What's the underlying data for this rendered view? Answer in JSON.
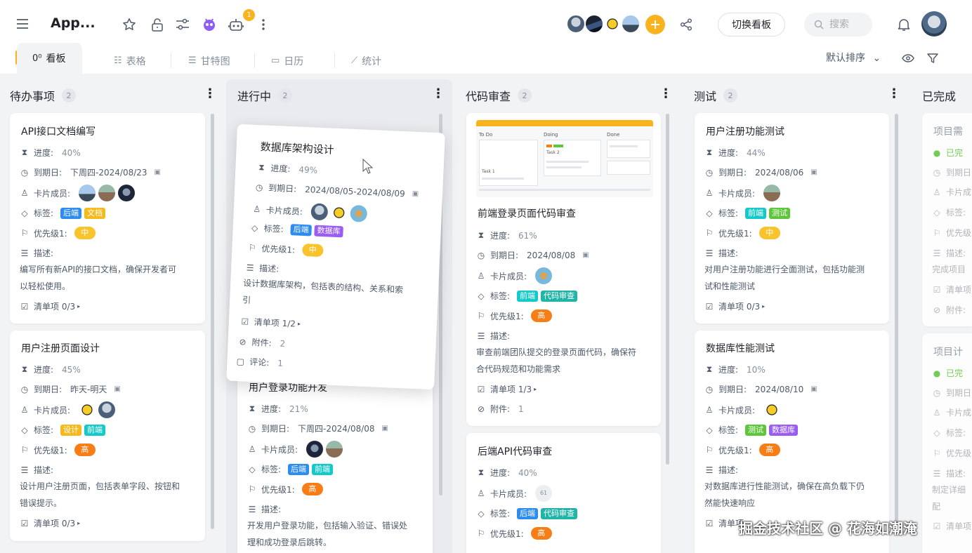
{
  "app": {
    "title": "App..."
  },
  "topbar": {
    "notification_count": "1",
    "switch_board_label": "切换看板",
    "search_placeholder": "搜索",
    "icons": [
      "menu-icon",
      "star-icon",
      "unlock-icon",
      "sliders-icon",
      "alien-icon",
      "robot-icon",
      "more-vertical-icon",
      "plus-icon",
      "share-icon",
      "bell-icon"
    ]
  },
  "tabs": [
    {
      "label": "看板",
      "glyph": "0⁰"
    },
    {
      "label": "表格",
      "glyph": "☷"
    },
    {
      "label": "甘特图",
      "glyph": "☰"
    },
    {
      "label": "日历",
      "glyph": "▭"
    },
    {
      "label": "统计",
      "glyph": "⟋"
    }
  ],
  "view": {
    "sort_label": "默认排序"
  },
  "fields": {
    "progress": "进度:",
    "due": "到期日:",
    "members": "卡片成员:",
    "tags": "标签:",
    "priority": "优先级1:",
    "desc": "描述:",
    "checklist": "清单项",
    "attach": "附件:",
    "comment": "评论:",
    "done": "已完"
  },
  "columns": [
    {
      "name": "待办事项",
      "count": "2"
    },
    {
      "name": "进行中",
      "count": "2"
    },
    {
      "name": "代码审查",
      "count": "2"
    },
    {
      "name": "测试",
      "count": "2"
    },
    {
      "name": "已完成",
      "count": ""
    }
  ],
  "cards": {
    "c1": {
      "title": "API接口文档编写",
      "progress": "40%",
      "due": "下周四-2024/08/23",
      "tags": [
        "后端",
        "文档"
      ],
      "priority": "中",
      "desc1": "编写所有新API的接口文档，确保开发者可",
      "desc2": "以轻松使用。",
      "checklist": "0/3"
    },
    "c2": {
      "title": "用户注册页面设计",
      "progress": "45%",
      "due": "昨天-明天",
      "tags": [
        "设计",
        "前端"
      ],
      "priority": "高",
      "desc1": "设计用户注册页面，包括表单字段、按钮和",
      "desc2": "错误提示。",
      "checklist": "0/3"
    },
    "drag": {
      "title": "数据库架构设计",
      "progress": "49%",
      "due": "2024/08/05-2024/08/09",
      "tags": [
        "后端",
        "数据库"
      ],
      "priority": "中",
      "desc1": "设计数据库架构，包括表的结构、关系和索",
      "desc2": "引",
      "checklist": "1/2",
      "attach": "2",
      "comment": "1"
    },
    "c3": {
      "title": "用户登录功能开发",
      "progress": "21%",
      "due": "下周四-2024/08/08",
      "tags": [
        "后端",
        "前端"
      ],
      "priority": "高",
      "desc1": "开发用户登录功能，包括输入验证、错误处",
      "desc2": "理和成功登录后跳转。"
    },
    "c4": {
      "title": "前端登录页面代码审查",
      "progress": "61%",
      "due": "2024/08/08",
      "tags": [
        "前端",
        "代码审查"
      ],
      "priority": "高",
      "desc1": "审查前端团队提交的登录页面代码，确保符",
      "desc2": "合代码规范和功能需求",
      "checklist": "1/3",
      "attach": "1",
      "preview": {
        "col1": "To Do",
        "col2": "Doing",
        "col3": "Done",
        "task1": "Task 1",
        "task2": "Task 2"
      }
    },
    "c5": {
      "title": "后端API代码审查",
      "progress": "40%",
      "member_initials": "61",
      "tags": [
        "后端",
        "代码审查"
      ],
      "priority": "高"
    },
    "c6": {
      "title": "用户注册功能测试",
      "progress": "44%",
      "due": "2024/08/06",
      "tags": [
        "前端",
        "测试"
      ],
      "priority": "中",
      "desc1": "对用户注册功能进行全面测试，包括功能测",
      "desc2": "试和性能测试",
      "checklist": "0/3"
    },
    "c7": {
      "title": "数据库性能测试",
      "progress": "10%",
      "due": "2024/08/10",
      "tags": [
        "测试",
        "数据库"
      ],
      "priority": "高",
      "desc1": "对数据库进行性能测试，确保在高负载下仍",
      "desc2": "然能快速响应"
    },
    "d1": {
      "title": "项目需",
      "desc": "完成项目"
    },
    "d2": {
      "title": "项目计",
      "desc1": "制定详细",
      "desc2": "配"
    }
  },
  "watermark": "掘金技术社区 @ 花海如潮淹",
  "colors": {
    "blue": "#2d8cf0",
    "yellow": "#f7ba1e",
    "cyan": "#14c9c9",
    "green": "#5ec63a",
    "purple": "#9a5df4",
    "orange": "#f77e17",
    "accent": "#f9b31f"
  }
}
